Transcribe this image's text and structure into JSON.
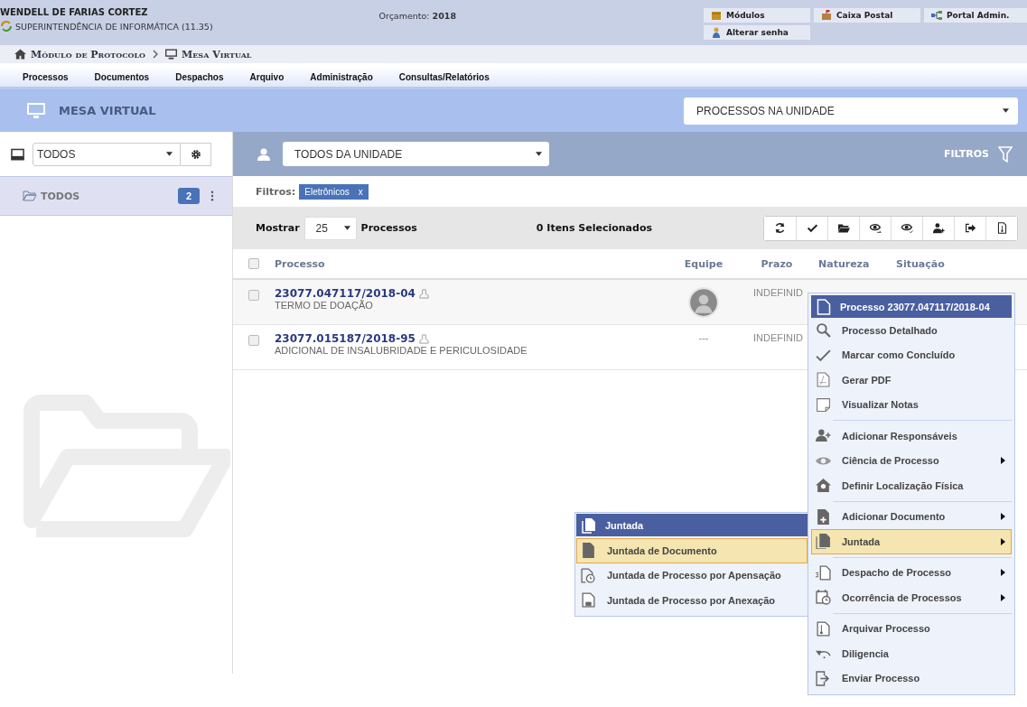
{
  "header": {
    "user": "WENDELL DE FARIAS CORTEZ",
    "unit": "SUPERINTENDÊNCIA DE INFORMÁTICA (11.35)",
    "budget_label": "Orçamento:",
    "budget_year": "2018",
    "links": [
      "Módulos",
      "Caixa Postal",
      "Portal Admin.",
      "Alterar senha"
    ]
  },
  "breadcrumb": [
    "Módulo de Protocolo",
    "Mesa Virtual"
  ],
  "menubar": [
    "Processos",
    "Documentos",
    "Despachos",
    "Arquivo",
    "Administração",
    "Consultas/Relatórios"
  ],
  "page_title": "MESA VIRTUAL",
  "view_select": "PROCESSOS NA UNIDADE",
  "sidebar": {
    "select": "TODOS",
    "items": [
      {
        "label": "TODOS",
        "count": "2",
        "selected": true
      }
    ]
  },
  "team_select": "TODOS DA UNIDADE",
  "filters_button": "FILTROS",
  "filter_label": "Filtros:",
  "filter_tags": [
    {
      "label": "Eletrônicos",
      "remove": "x"
    }
  ],
  "toolbar": {
    "show_label": "Mostrar",
    "page_size": "25",
    "unit_label": "Processos",
    "selected_count": "0 Itens Selecionados"
  },
  "table": {
    "all_checked": false,
    "columns": [
      "Processo",
      "Equipe",
      "Prazo",
      "Natureza",
      "Situação"
    ],
    "rows": [
      {
        "number": "23077.047117/2018-04",
        "subject": "TERMO DE DOAÇÃO",
        "team": null,
        "deadline": "INDEFINID",
        "checked": false
      },
      {
        "number": "23077.015187/2018-95",
        "subject": "ADICIONAL DE INSALUBRIDADE E PERICULOSIDADE",
        "team": "---",
        "deadline": "INDEFINID",
        "checked": false
      }
    ]
  },
  "context_menu": {
    "title": "Processo 23077.047117/2018-04",
    "groups": [
      {
        "items": [
          {
            "label": "Processo Detalhado",
            "submenu": false,
            "selected": false
          },
          {
            "label": "Marcar como Concluído",
            "submenu": false,
            "selected": false
          },
          {
            "label": "Gerar PDF",
            "submenu": false,
            "selected": false
          },
          {
            "label": "Visualizar Notas",
            "submenu": false,
            "selected": false
          }
        ]
      },
      {
        "items": [
          {
            "label": "Adicionar Responsáveis",
            "submenu": false,
            "selected": false
          },
          {
            "label": "Ciência de Processo",
            "submenu": true,
            "selected": false
          },
          {
            "label": "Definir Localização Física",
            "submenu": false,
            "selected": false
          }
        ]
      },
      {
        "items": [
          {
            "label": "Adicionar Documento",
            "submenu": true,
            "selected": false
          },
          {
            "label": "Juntada",
            "submenu": true,
            "selected": true
          }
        ]
      },
      {
        "items": [
          {
            "label": "Despacho de Processo",
            "submenu": true,
            "selected": false
          },
          {
            "label": "Ocorrência de Processos",
            "submenu": true,
            "selected": false
          }
        ]
      },
      {
        "items": [
          {
            "label": "Arquivar Processo",
            "submenu": false,
            "selected": false
          },
          {
            "label": "Diligencia",
            "submenu": false,
            "selected": false
          },
          {
            "label": "Enviar Processo",
            "submenu": false,
            "selected": false
          }
        ]
      }
    ]
  },
  "submenu": {
    "title": "Juntada",
    "items": [
      {
        "label": "Juntada de Documento",
        "selected": true
      },
      {
        "label": "Juntada de Processo por Apensação",
        "selected": false
      },
      {
        "label": "Juntada de Processo por Anexação",
        "selected": false
      }
    ]
  }
}
